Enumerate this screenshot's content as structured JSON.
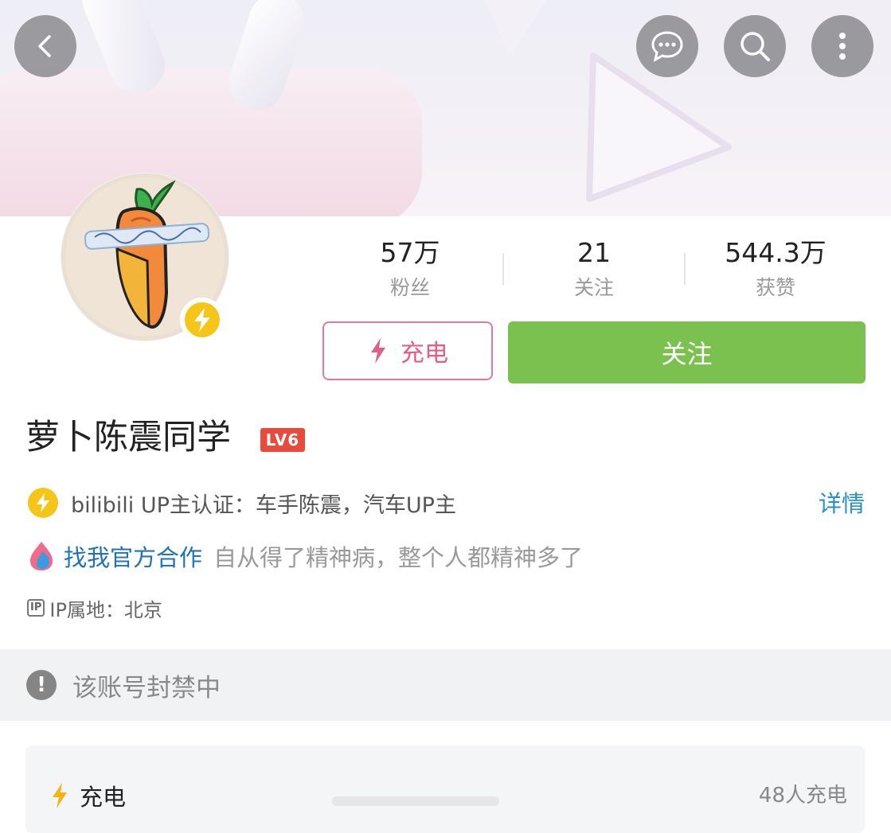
{
  "header": {
    "back_icon": "back-chevron-icon",
    "message_icon": "message-bubble-icon",
    "search_icon": "search-icon",
    "more_icon": "more-vertical-icon"
  },
  "profile": {
    "stats": [
      {
        "value": "57万",
        "label": "粉丝"
      },
      {
        "value": "21",
        "label": "关注"
      },
      {
        "value": "544.3万",
        "label": "获赞"
      }
    ],
    "charge_label": "充电",
    "follow_label": "关注",
    "name": "萝卜陈震同学",
    "level": "LV6",
    "verification": "bilibili UP主认证：车手陈震，汽车UP主",
    "detail_label": "详情",
    "cooperation_link": "找我官方合作",
    "signature": "自从得了精神病，整个人都精神多了",
    "ip_badge": "IP",
    "ip_location": "IP属地：北京"
  },
  "notice": {
    "text": "该账号封禁中"
  },
  "charge_card": {
    "title": "充电",
    "count": "48人充电"
  },
  "colors": {
    "follow_button": "#7bc150",
    "charge_border": "#e07a9a",
    "link_blue": "#2173b5",
    "level_badge": "#e84a3c",
    "verify_yellow": "#f5c518"
  }
}
